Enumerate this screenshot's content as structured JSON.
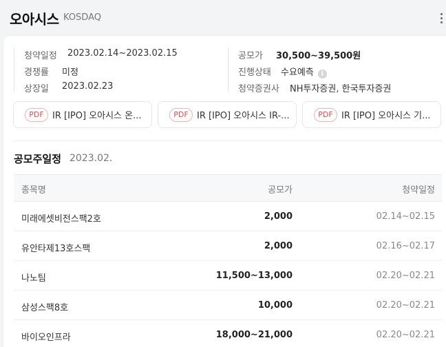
{
  "header": {
    "title": "오아시스",
    "market": "KOSDAQ"
  },
  "info": {
    "left": [
      {
        "label": "청약일정",
        "value": "2023.02.14~2023.02.15"
      },
      {
        "label": "경쟁률",
        "value": "미정"
      },
      {
        "label": "상장일",
        "value": "2023.02.23"
      }
    ],
    "right": [
      {
        "label": "공모가",
        "value": "30,500~39,500원"
      },
      {
        "label": "진행상태",
        "value": "수요예측"
      },
      {
        "label": "청약증권사",
        "value": "NH투자증권, 한국투자증권"
      }
    ]
  },
  "documents": [
    {
      "badge": "PDF",
      "title": "IR [IPO] 오아시스 온..."
    },
    {
      "badge": "PDF",
      "title": "IR [IPO] 오아시스 IR-..."
    },
    {
      "badge": "PDF",
      "title": "IR [IPO] 오아시스 기..."
    }
  ],
  "schedule": {
    "title": "공모주일정",
    "month": "2023.02.",
    "columns": {
      "name": "종목명",
      "price": "공모가",
      "date": "청약일정"
    },
    "rows": [
      {
        "name": "미래에셋비전스팩2호",
        "price": "2,000",
        "date": "02.14~02.15"
      },
      {
        "name": "유안타제13호스팩",
        "price": "2,000",
        "date": "02.16~02.17"
      },
      {
        "name": "나노팀",
        "price": "11,500~13,000",
        "date": "02.20~02.21"
      },
      {
        "name": "삼성스팩8호",
        "price": "10,000",
        "date": "02.20~02.21"
      },
      {
        "name": "바이오인프라",
        "price": "18,000~21,000",
        "date": "02.20~02.21"
      }
    ]
  },
  "colors": {
    "pdf_badge": "#e74c4c",
    "background": "#f3f4f6"
  }
}
